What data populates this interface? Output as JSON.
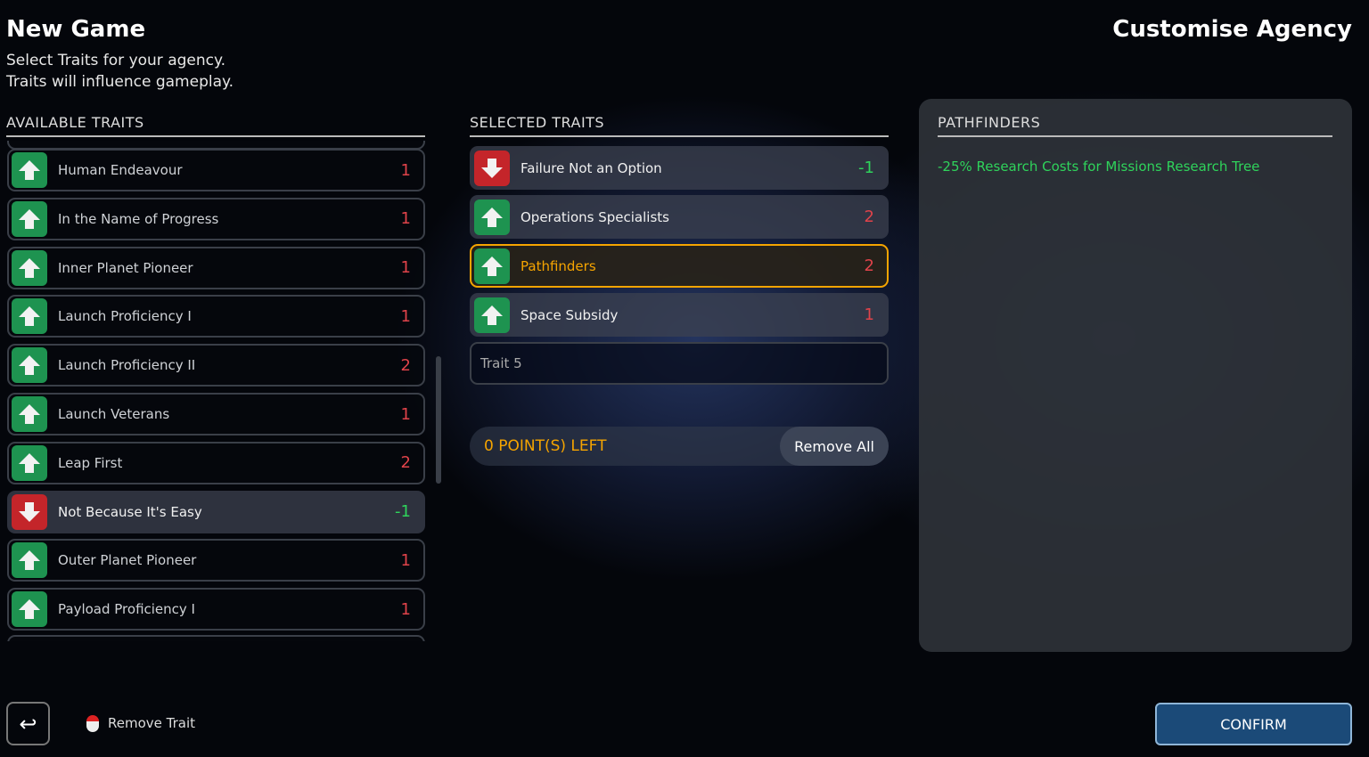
{
  "header": {
    "title": "New Game",
    "subtitle1": "Select Traits for your agency.",
    "subtitle2": "Traits will influence gameplay.",
    "right_title": "Customise Agency"
  },
  "available": {
    "heading": "AVAILABLE TRAITS",
    "items": [
      {
        "label": "Human Endeavour",
        "value": "1",
        "type": "up"
      },
      {
        "label": "In the Name of Progress",
        "value": "1",
        "type": "up"
      },
      {
        "label": "Inner Planet Pioneer",
        "value": "1",
        "type": "up"
      },
      {
        "label": "Launch Proficiency I",
        "value": "1",
        "type": "up"
      },
      {
        "label": "Launch Proficiency II",
        "value": "2",
        "type": "up"
      },
      {
        "label": "Launch Veterans",
        "value": "1",
        "type": "up"
      },
      {
        "label": "Leap First",
        "value": "2",
        "type": "up"
      },
      {
        "label": "Not Because It's Easy",
        "value": "-1",
        "type": "down",
        "selected": true
      },
      {
        "label": "Outer Planet Pioneer",
        "value": "1",
        "type": "up"
      },
      {
        "label": "Payload Proficiency I",
        "value": "1",
        "type": "up"
      }
    ]
  },
  "selected": {
    "heading": "SELECTED TRAITS",
    "items": [
      {
        "label": "Failure Not an Option",
        "value": "-1",
        "type": "down"
      },
      {
        "label": "Operations Specialists",
        "value": "2",
        "type": "up"
      },
      {
        "label": "Pathfinders",
        "value": "2",
        "type": "up",
        "highlight": true
      },
      {
        "label": "Space Subsidy",
        "value": "1",
        "type": "up"
      }
    ],
    "empty_slot": "Trait 5",
    "points_left": "0 POINT(S) LEFT",
    "remove_all": "Remove All"
  },
  "detail": {
    "title": "PATHFINDERS",
    "description": "-25% Research Costs for Missions Research Tree"
  },
  "footer": {
    "remove_trait": "Remove Trait",
    "confirm": "CONFIRM"
  },
  "colors": {
    "accent": "#f5a400",
    "positive": "#2fd35b",
    "cost": "#e0434a",
    "confirm": "#1b4a78"
  }
}
